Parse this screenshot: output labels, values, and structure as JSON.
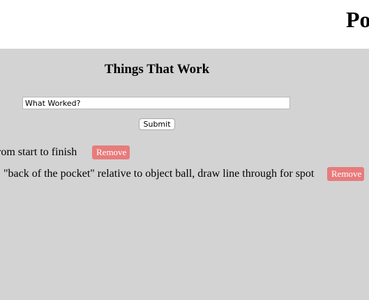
{
  "header": {
    "title_visible": "Po"
  },
  "section": {
    "title": "Things That Work"
  },
  "form": {
    "input_value": "What Worked?",
    "submit_label": "Submit"
  },
  "items": [
    {
      "text": "rom start to finish",
      "remove_label": "Remove"
    },
    {
      "text": "\"back of the pocket\" relative to object ball, draw line through for spot",
      "remove_label": "Remove"
    }
  ],
  "colors": {
    "panel_background": "#d3d3d3",
    "remove_button": "#e87b7b",
    "header_background": "#ffffff"
  }
}
